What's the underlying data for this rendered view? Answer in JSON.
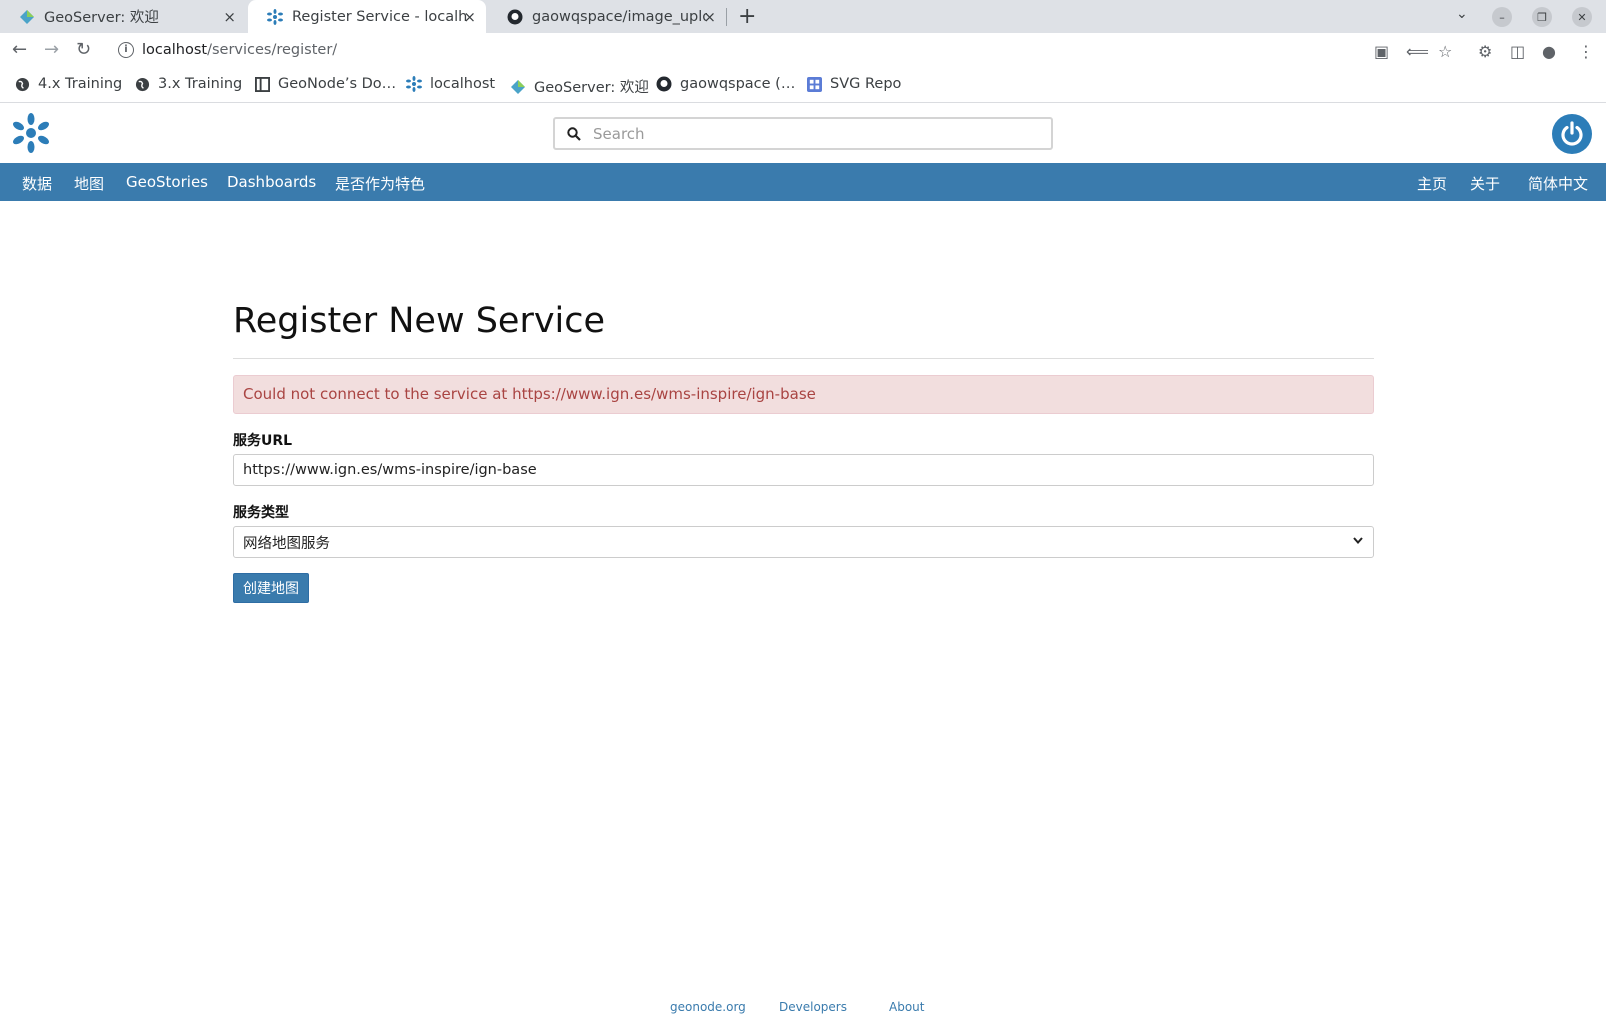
{
  "browser": {
    "tabs": [
      {
        "title": "GeoServer: 欢迎",
        "close": "×"
      },
      {
        "title": "Register Service - localhost",
        "close": "×"
      },
      {
        "title": "gaowqspace/image_uploads",
        "close": "×"
      }
    ],
    "new_tab": "+",
    "url_host": "localhost",
    "url_path": "/services/register/",
    "bookmarks": [
      {
        "label": "4.x Training",
        "icon": "globe-icon"
      },
      {
        "label": "3.x Training",
        "icon": "globe-icon"
      },
      {
        "label": "GeoNode’s Do…",
        "icon": "docs-icon"
      },
      {
        "label": "localhost",
        "icon": "geonode-icon"
      },
      {
        "label": "GeoServer: 欢迎",
        "icon": "geoserver-icon"
      },
      {
        "label": "gaowqspace (…",
        "icon": "github-icon"
      },
      {
        "label": "SVG Repo",
        "icon": "svgrepo-icon"
      }
    ]
  },
  "header": {
    "search_placeholder": "Search"
  },
  "navbar": {
    "left": [
      "数据",
      "地图",
      "GeoStories",
      "Dashboards",
      "是否作为特色"
    ],
    "right": [
      "主页",
      "关于",
      "简体中文"
    ]
  },
  "page": {
    "title": "Register New Service",
    "error": "Could not connect to the service at https://www.ign.es/wms-inspire/ign-base",
    "url_label": "服务URL",
    "url_value": "https://www.ign.es/wms-inspire/ign-base",
    "type_label": "服务类型",
    "type_value": "网络地图服务",
    "submit_label": "创建地图"
  },
  "footer": {
    "links": [
      "geonode.org",
      "Developers",
      "About"
    ]
  },
  "colors": {
    "navbar": "#3a7bad",
    "brand": "#2c7db8",
    "alert_bg": "#f2dede",
    "alert_text": "#a94442"
  }
}
